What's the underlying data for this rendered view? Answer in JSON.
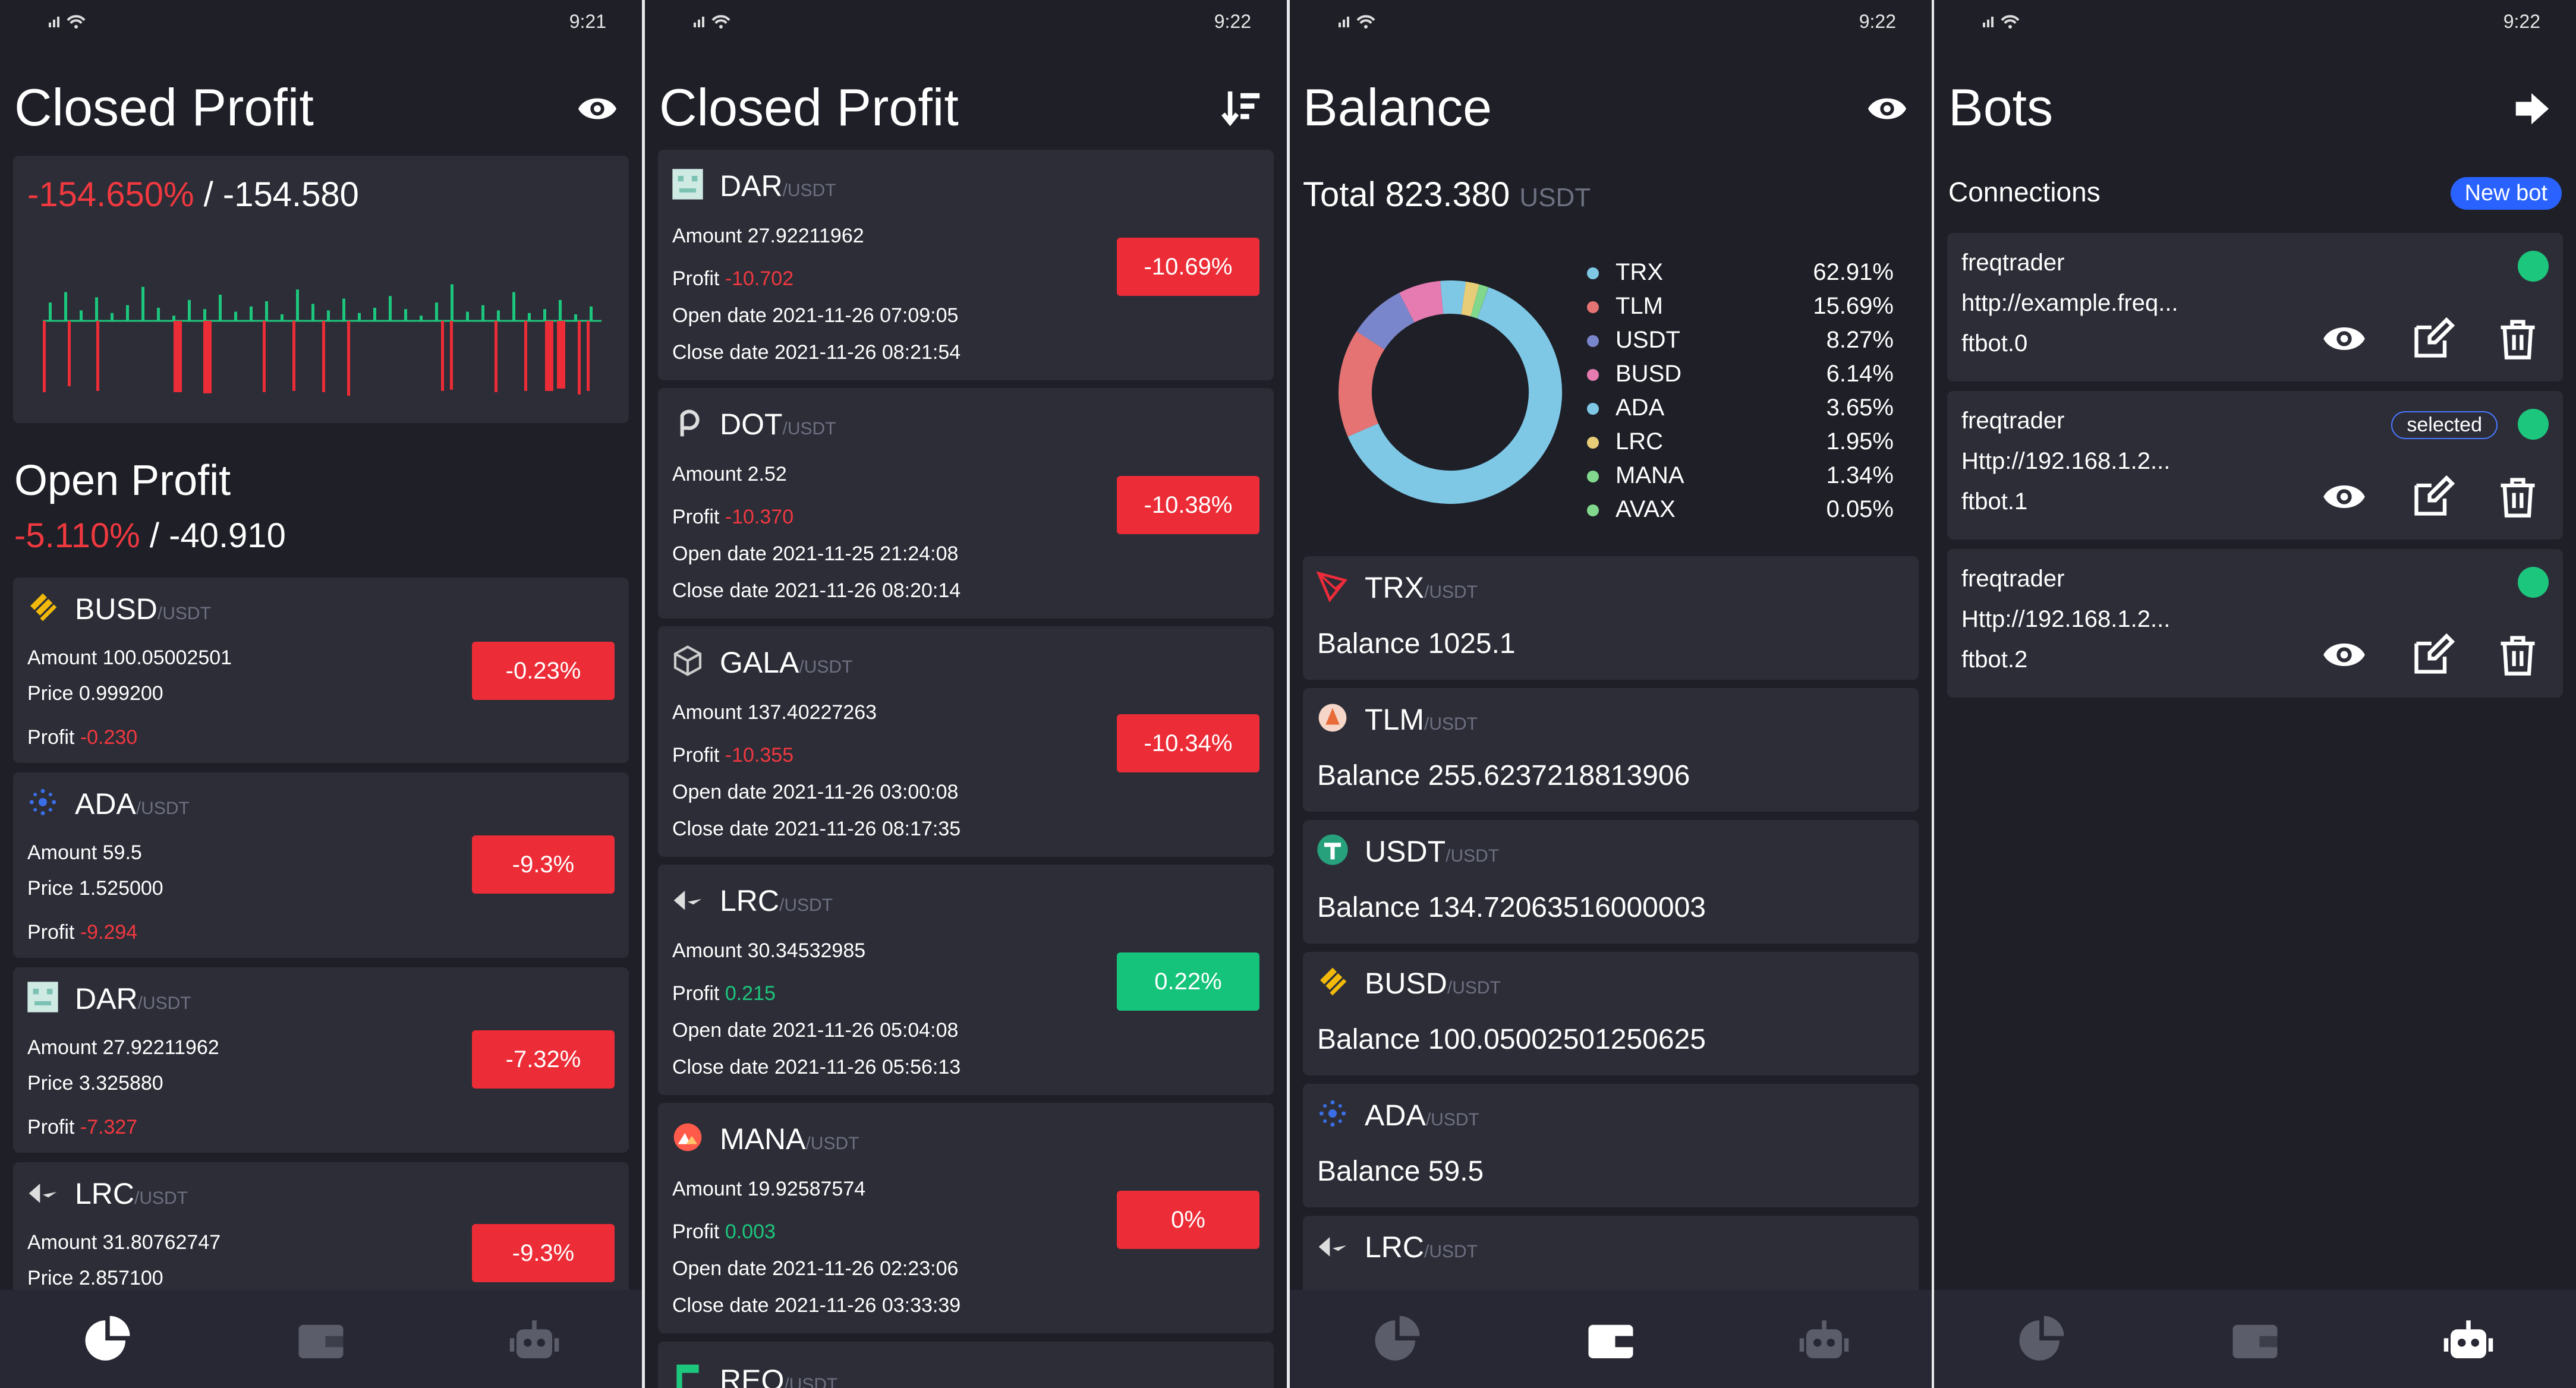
{
  "phones": {
    "p1": {
      "time": "9:21",
      "title": "Closed Profit",
      "closed_pct": "-154.650%",
      "closed_sep": "/",
      "closed_abs": "-154.580",
      "open_title": "Open Profit",
      "open_pct": "-5.110%",
      "open_sep": "/",
      "open_abs": "-40.910",
      "positions": [
        {
          "symbol": "BUSD",
          "quote": "/USDT",
          "amount": "Amount 100.05002501",
          "price": "Price 0.999200",
          "profit_label": "Profit",
          "profit_value": "-0.230",
          "badge": "-0.23%"
        },
        {
          "symbol": "ADA",
          "quote": "/USDT",
          "amount": "Amount 59.5",
          "price": "Price 1.525000",
          "profit_label": "Profit",
          "profit_value": "-9.294",
          "badge": "-9.3%"
        },
        {
          "symbol": "DAR",
          "quote": "/USDT",
          "amount": "Amount 27.92211962",
          "price": "Price 3.325880",
          "profit_label": "Profit",
          "profit_value": "-7.327",
          "badge": "-7.32%"
        },
        {
          "symbol": "LRC",
          "quote": "/USDT",
          "amount": "Amount 31.80762747",
          "price": "Price 2.857100",
          "profit_label": "",
          "profit_value": "",
          "badge": "-9.3%"
        }
      ]
    },
    "p2": {
      "time": "9:22",
      "title": "Closed Profit",
      "trades": [
        {
          "symbol": "DAR",
          "quote": "/USDT",
          "amount": "Amount 27.92211962",
          "profit_label": "Profit",
          "profit_value": "-10.702",
          "open": "Open date 2021-11-26 07:09:05",
          "close": "Close date 2021-11-26 08:21:54",
          "badge": "-10.69%",
          "positive": false
        },
        {
          "symbol": "DOT",
          "quote": "/USDT",
          "amount": "Amount 2.52",
          "profit_label": "Profit",
          "profit_value": "-10.370",
          "open": "Open date 2021-11-25 21:24:08",
          "close": "Close date 2021-11-26 08:20:14",
          "badge": "-10.38%",
          "positive": false
        },
        {
          "symbol": "GALA",
          "quote": "/USDT",
          "amount": "Amount 137.40227263",
          "profit_label": "Profit",
          "profit_value": "-10.355",
          "open": "Open date 2021-11-26 03:00:08",
          "close": "Close date 2021-11-26 08:17:35",
          "badge": "-10.34%",
          "positive": false
        },
        {
          "symbol": "LRC",
          "quote": "/USDT",
          "amount": "Amount 30.34532985",
          "profit_label": "Profit",
          "profit_value": "0.215",
          "open": "Open date 2021-11-26 05:04:08",
          "close": "Close date 2021-11-26 05:56:13",
          "badge": "0.22%",
          "positive": true
        },
        {
          "symbol": "MANA",
          "quote": "/USDT",
          "amount": "Amount 19.92587574",
          "profit_label": "Profit",
          "profit_value": "0.003",
          "open": "Open date 2021-11-26 02:23:06",
          "close": "Close date 2021-11-26 03:33:39",
          "badge": "0%",
          "positive": false
        },
        {
          "symbol": "REQ",
          "quote": "/USDT"
        }
      ]
    },
    "p3": {
      "time": "9:22",
      "title": "Balance",
      "total_label": "Total",
      "total_value": "823.380",
      "total_unit": "USDT",
      "legend": [
        {
          "name": "TRX",
          "pct": "62.91%",
          "value": 62.91,
          "color": "#7ec8e6"
        },
        {
          "name": "TLM",
          "pct": "15.69%",
          "value": 15.69,
          "color": "#e57373"
        },
        {
          "name": "USDT",
          "pct": "8.27%",
          "value": 8.27,
          "color": "#7986cb"
        },
        {
          "name": "BUSD",
          "pct": "6.14%",
          "value": 6.14,
          "color": "#e57bb0"
        },
        {
          "name": "ADA",
          "pct": "3.65%",
          "value": 3.65,
          "color": "#7ec8e6"
        },
        {
          "name": "LRC",
          "pct": "1.95%",
          "value": 1.95,
          "color": "#e8cd78"
        },
        {
          "name": "MANA",
          "pct": "1.34%",
          "value": 1.34,
          "color": "#81d88c"
        },
        {
          "name": "AVAX",
          "pct": "0.05%",
          "value": 0.05,
          "color": "#81d88c"
        }
      ],
      "balances": [
        {
          "symbol": "TRX",
          "quote": "/USDT",
          "balance": "Balance 1025.1"
        },
        {
          "symbol": "TLM",
          "quote": "/USDT",
          "balance": "Balance 255.6237218813906"
        },
        {
          "symbol": "USDT",
          "quote": "/USDT",
          "balance": "Balance 134.72063516000003"
        },
        {
          "symbol": "BUSD",
          "quote": "/USDT",
          "balance": "Balance 100.05002501250625"
        },
        {
          "symbol": "ADA",
          "quote": "/USDT",
          "balance": "Balance 59.5"
        },
        {
          "symbol": "LRC",
          "quote": "/USDT",
          "balance": ""
        }
      ]
    },
    "p4": {
      "time": "9:22",
      "title": "Bots",
      "connections_label": "Connections",
      "new_bot": "New bot",
      "bots": [
        {
          "name": "freqtrader",
          "url": "http://example.freq...",
          "bot": "ftbot.0",
          "selected": ""
        },
        {
          "name": "freqtrader",
          "url": "Http://192.168.1.2...",
          "bot": "ftbot.1",
          "selected": "selected"
        },
        {
          "name": "freqtrader",
          "url": "Http://192.168.1.2...",
          "bot": "ftbot.2",
          "selected": ""
        }
      ]
    }
  },
  "colors": {
    "background": "#1e1f27",
    "card": "#2c2d37",
    "negative": "#ec2c36",
    "positive": "#15c47a",
    "accent": "#2962ff",
    "status_dot": "#1dc67d"
  }
}
